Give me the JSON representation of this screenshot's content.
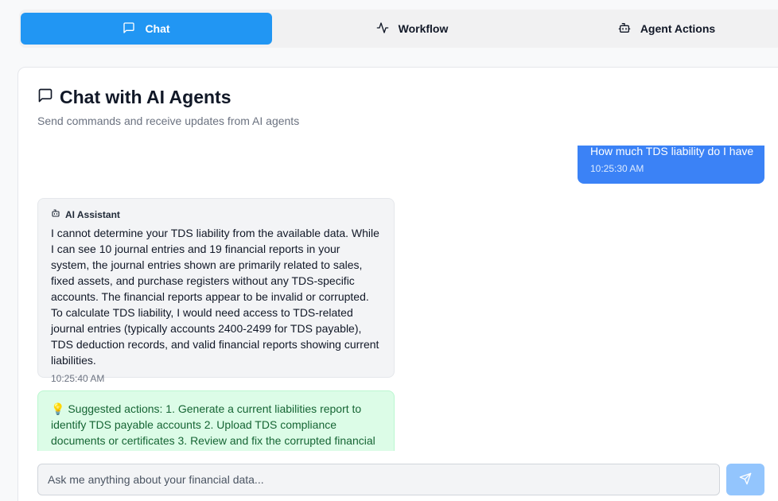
{
  "tabs": [
    {
      "label": "Chat",
      "icon": "message-square-icon",
      "active": true
    },
    {
      "label": "Workflow",
      "icon": "activity-icon",
      "active": false
    },
    {
      "label": "Agent Actions",
      "icon": "bot-icon",
      "active": false
    }
  ],
  "header": {
    "title": "Chat with AI Agents",
    "subtitle": "Send commands and receive updates from AI agents"
  },
  "messages": {
    "user": {
      "text": "How much TDS liability do I have",
      "time": "10:25:30 AM"
    },
    "assistant": {
      "sender": "AI Assistant",
      "text": "I cannot determine your TDS liability from the available data. While I can see 10 journal entries and 19 financial reports in your system, the journal entries shown are primarily related to sales, fixed assets, and purchase registers without any TDS-specific accounts. The financial reports appear to be invalid or corrupted. To calculate TDS liability, I would need access to TDS-related journal entries (typically accounts 2400-2499 for TDS payable), TDS deduction records, and valid financial reports showing current liabilities.",
      "time": "10:25:40 AM"
    },
    "suggestion": {
      "icon": "lightbulb-icon",
      "emoji": "💡",
      "text": "Suggested actions: 1. Generate a current liabilities report to identify TDS payable accounts 2. Upload TDS compliance documents or certificates 3. Review and fix the corrupted financial"
    }
  },
  "input": {
    "placeholder": "Ask me anything about your financial data..."
  },
  "colors": {
    "accent": "#2196f3",
    "user_bubble": "#3b82f6",
    "suggestion_bg": "#dcfce7",
    "send_button": "#93c5fd"
  }
}
